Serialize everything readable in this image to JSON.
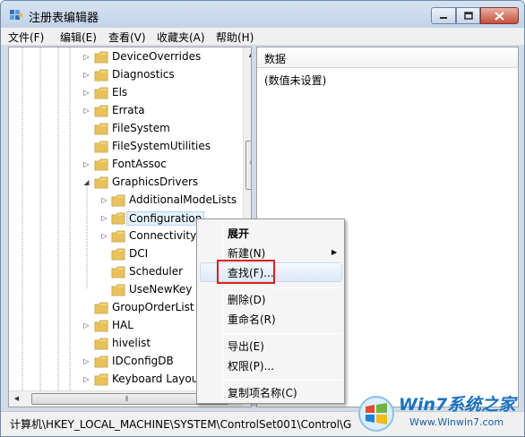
{
  "window": {
    "title": "注册表编辑器",
    "controls": {
      "minimize": "minimize",
      "maximize": "maximize",
      "close": "close"
    }
  },
  "menubar": [
    "文件(F)",
    "编辑(E)",
    "查看(V)",
    "收藏夹(A)",
    "帮助(H)"
  ],
  "tree": {
    "items": [
      {
        "label": "DeviceOverrides",
        "level": 0,
        "expander": "collapsed"
      },
      {
        "label": "Diagnostics",
        "level": 0,
        "expander": "collapsed"
      },
      {
        "label": "Els",
        "level": 0,
        "expander": "collapsed"
      },
      {
        "label": "Errata",
        "level": 0,
        "expander": "collapsed"
      },
      {
        "label": "FileSystem",
        "level": 0,
        "expander": "none"
      },
      {
        "label": "FileSystemUtilities",
        "level": 0,
        "expander": "none"
      },
      {
        "label": "FontAssoc",
        "level": 0,
        "expander": "collapsed"
      },
      {
        "label": "GraphicsDrivers",
        "level": 0,
        "expander": "expanded"
      },
      {
        "label": "AdditionalModeLists",
        "level": 1,
        "expander": "collapsed"
      },
      {
        "label": "Configuration",
        "level": 1,
        "expander": "collapsed",
        "selected": true
      },
      {
        "label": "Connectivity",
        "level": 1,
        "expander": "collapsed"
      },
      {
        "label": "DCI",
        "level": 1,
        "expander": "none"
      },
      {
        "label": "Scheduler",
        "level": 1,
        "expander": "none"
      },
      {
        "label": "UseNewKey",
        "level": 1,
        "expander": "none"
      },
      {
        "label": "GroupOrderList",
        "level": 0,
        "expander": "none"
      },
      {
        "label": "HAL",
        "level": 0,
        "expander": "collapsed"
      },
      {
        "label": "hivelist",
        "level": 0,
        "expander": "none"
      },
      {
        "label": "IDConfigDB",
        "level": 0,
        "expander": "collapsed"
      },
      {
        "label": "Keyboard Layou",
        "level": 0,
        "expander": "collapsed"
      },
      {
        "label": "Keyboard La",
        "level": 0,
        "expander": "collapsed"
      }
    ]
  },
  "list": {
    "column_header": "数据",
    "value": "(数值未设置)"
  },
  "status_path": "计算机\\HKEY_LOCAL_MACHINE\\SYSTEM\\ControlSet001\\Control\\G",
  "context_menu": {
    "items": [
      {
        "label": "展开",
        "bold": true
      },
      {
        "label": "新建(N)",
        "submenu": true
      },
      {
        "label": "查找(F)...",
        "hovered": true
      },
      {
        "label": "删除(D)"
      },
      {
        "label": "重命名(R)"
      },
      {
        "label": "导出(E)"
      },
      {
        "label": "权限(P)..."
      },
      {
        "label": "复制项名称(C)"
      }
    ]
  },
  "watermark": {
    "brand": "Win7系统之家",
    "url": "Www.Winwin7.com"
  },
  "colors": {
    "highlight": "#e0201e",
    "folder": "#e8c15a",
    "selection": "#e5f1fb"
  }
}
